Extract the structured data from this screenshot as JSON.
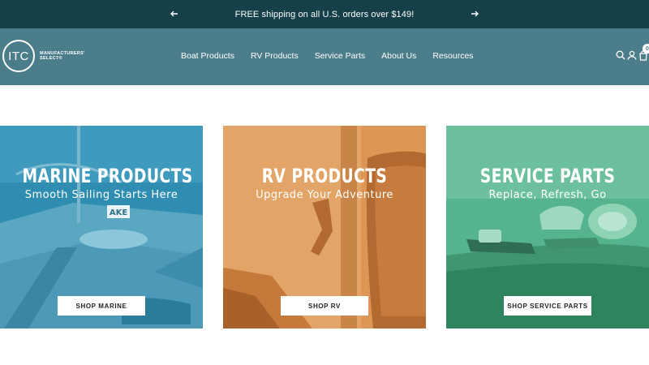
{
  "announcement": {
    "message": "FREE shipping on all U.S. orders over $149!",
    "prev_icon": "arrow-left-icon",
    "next_icon": "arrow-right-icon"
  },
  "header": {
    "logo": {
      "mark": "ITC",
      "line1": "MANUFACTURERS'",
      "line2": "SELECT®"
    },
    "nav": [
      "Boat Products",
      "RV Products",
      "Service Parts",
      "About Us",
      "Resources"
    ],
    "icons": [
      "search-icon",
      "account-icon",
      "cart-icon"
    ],
    "cart_count": "0"
  },
  "categories": [
    {
      "title": "MARINE PRODUCTS",
      "subtitle": "Smooth Sailing Starts Here",
      "button": "SHOP MARINE",
      "overlay_color": "#2f8fb0"
    },
    {
      "title": "RV PRODUCTS",
      "subtitle": "Upgrade Your Adventure",
      "button": "SHOP RV",
      "overlay_color": "#e0995a"
    },
    {
      "title": "SERVICE PARTS",
      "subtitle": "Replace, Refresh, Go",
      "button": "SHOP SERVICE PARTS",
      "overlay_color": "#4fb089"
    }
  ],
  "colors": {
    "announcement_bg": "#153f49",
    "header_bg": "#4b7d8b"
  }
}
